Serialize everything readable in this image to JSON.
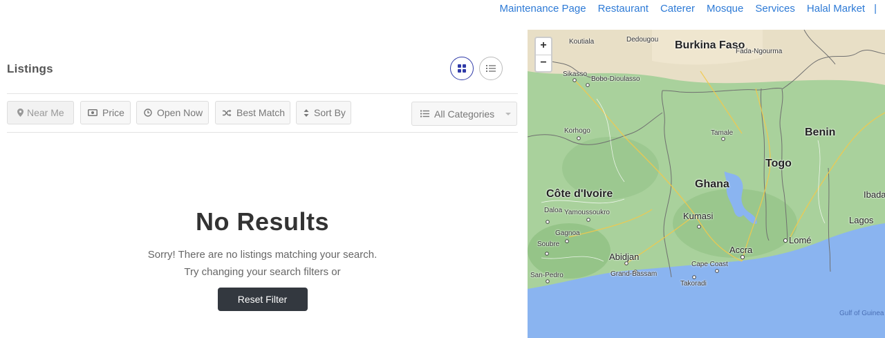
{
  "nav": {
    "items": [
      "Maintenance Page",
      "Restaurant",
      "Caterer",
      "Mosque",
      "Services",
      "Halal Market"
    ],
    "separator": "|"
  },
  "listings": {
    "title": "Listings",
    "view_grid_icon": "grid-icon",
    "view_list_icon": "list-icon"
  },
  "filters": {
    "near_me": "Near Me",
    "price": "Price",
    "open_now": "Open Now",
    "best_match": "Best Match",
    "sort_by": "Sort By",
    "categories": "All Categories"
  },
  "empty_state": {
    "heading": "No Results",
    "line1": "Sorry! There are no listings matching your search.",
    "line2": "Try changing your search filters or",
    "reset_label": "Reset Filter"
  },
  "map": {
    "zoom_in": "+",
    "zoom_out": "−",
    "countries": [
      "Burkina Faso",
      "Benin",
      "Togo",
      "Ghana",
      "Côte d'Ivoire"
    ],
    "cities": [
      "Kumasi",
      "Accra",
      "Lomé",
      "Abidjan",
      "Lagos",
      "Ibadan"
    ],
    "towns": [
      "Koutiala",
      "Dedougou",
      "Fada-Ngourma",
      "Sikasso",
      "Bobo-Dioulasso",
      "Korhogo",
      "Tamale",
      "Daloa",
      "Yamoussoukro",
      "Gagnoa",
      "Soubre",
      "San-Pedro",
      "Grand-Bassam",
      "Cape Coast",
      "Takoradi"
    ],
    "sea": "Gulf of Guinea",
    "colors": {
      "land": "#a7cf9c",
      "sea": "#8ab4f0",
      "accent": "#2f3aa8"
    }
  }
}
